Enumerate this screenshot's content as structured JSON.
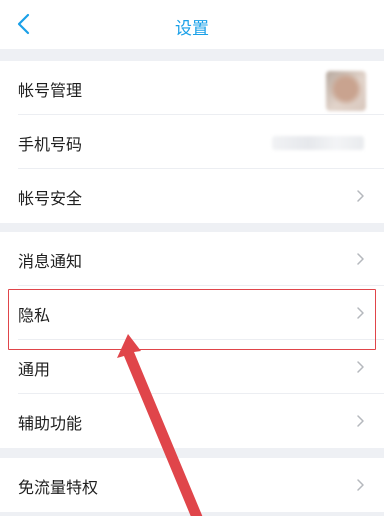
{
  "header": {
    "title": "设置"
  },
  "groups": {
    "account": {
      "items": [
        {
          "label": "帐号管理"
        },
        {
          "label": "手机号码"
        },
        {
          "label": "帐号安全"
        }
      ]
    },
    "general": {
      "items": [
        {
          "label": "消息通知"
        },
        {
          "label": "隐私"
        },
        {
          "label": "通用"
        },
        {
          "label": "辅助功能"
        }
      ]
    },
    "data": {
      "items": [
        {
          "label": "免流量特权"
        }
      ]
    }
  },
  "colors": {
    "accent": "#1aa0e8",
    "annotation": "#e0454a",
    "background": "#eef0f4"
  }
}
